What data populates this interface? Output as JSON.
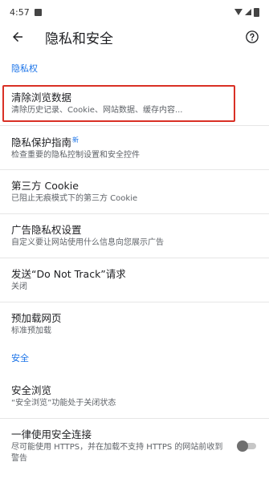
{
  "status": {
    "time": "4:57"
  },
  "app": {
    "title": "隐私和安全"
  },
  "sections": {
    "privacy_header": "隐私权",
    "security_header": "安全"
  },
  "items": {
    "clear_data": {
      "title": "清除浏览数据",
      "subtitle": "清除历史记录、Cookie、网站数据、缓存内容..."
    },
    "privacy_guide": {
      "title": "隐私保护指南",
      "badge": "新",
      "subtitle": "检查重要的隐私控制设置和安全控件"
    },
    "third_party_cookie": {
      "title": "第三方 Cookie",
      "subtitle": "已阻止无痕模式下的第三方 Cookie"
    },
    "ad_privacy": {
      "title": "广告隐私权设置",
      "subtitle": "自定义要让网站使用什么信息向您展示广告"
    },
    "do_not_track": {
      "title": "发送“Do Not Track”请求",
      "subtitle": "关闭"
    },
    "preload": {
      "title": "预加载网页",
      "subtitle": "标准预加载"
    },
    "safe_browsing": {
      "title": "安全浏览",
      "subtitle": "“安全浏览”功能处于关闭状态"
    },
    "https_always": {
      "title": "一律使用安全连接",
      "subtitle": "尽可能使用 HTTPS，并在加载不支持 HTTPS 的网站前收到警告",
      "toggle_on": false
    }
  }
}
